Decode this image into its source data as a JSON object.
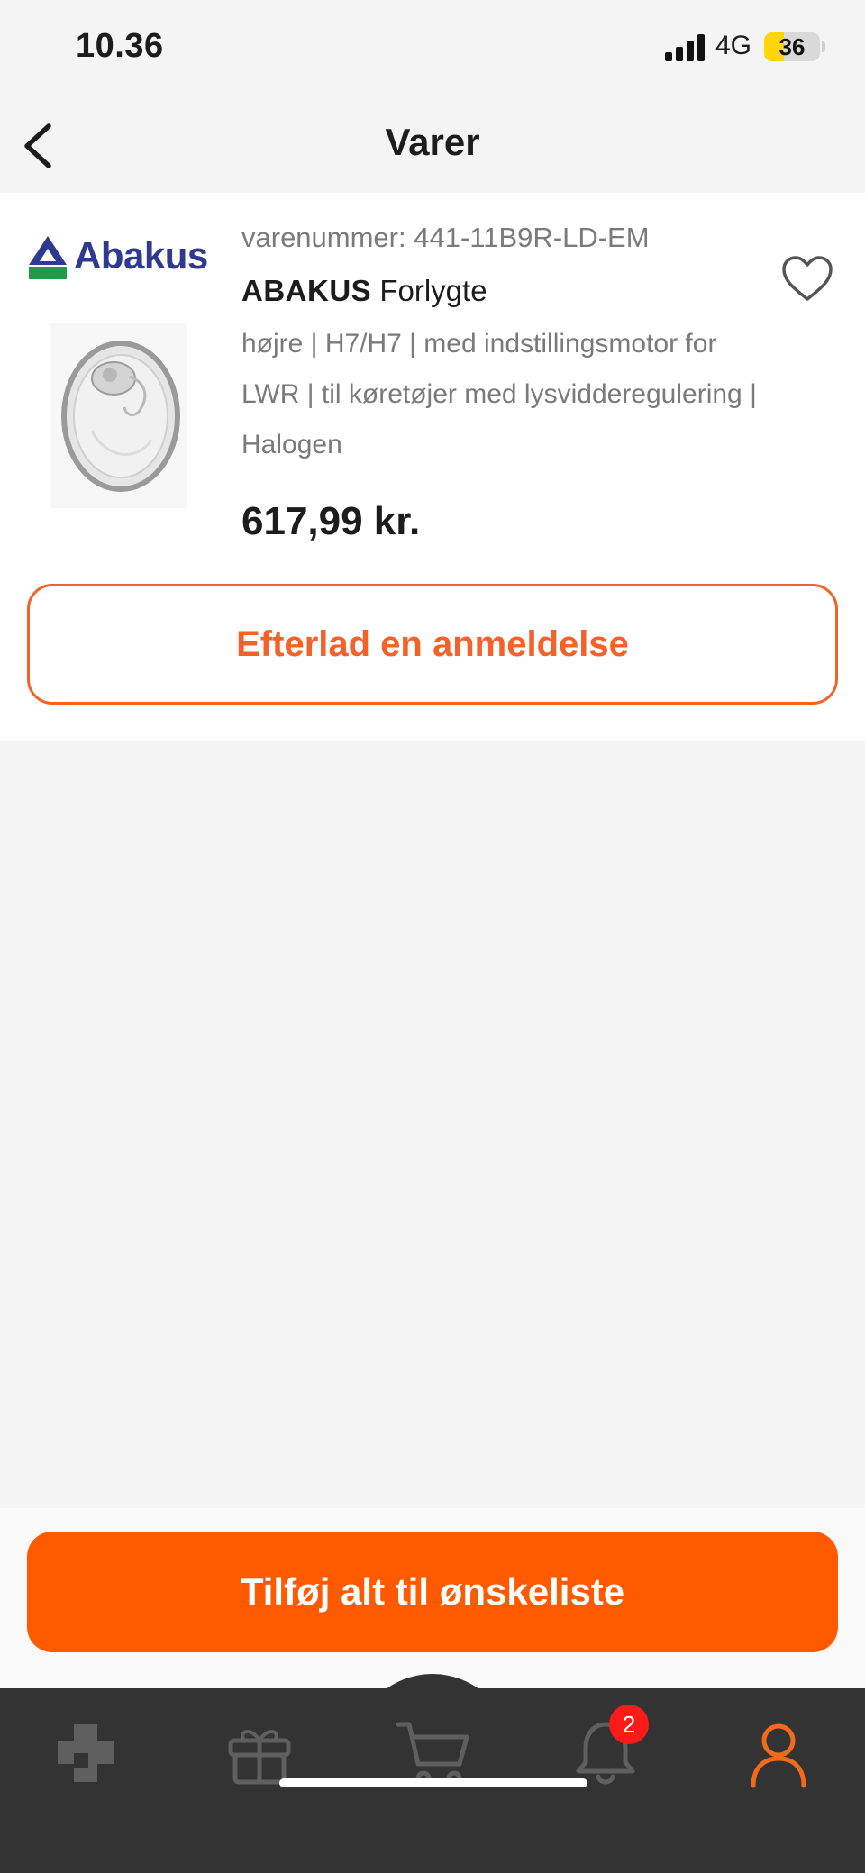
{
  "status_bar": {
    "time": "10.36",
    "network": "4G",
    "battery_level": "36",
    "battery_fraction": 0.36
  },
  "header": {
    "title": "Varer",
    "back_icon": "chevron-left-icon"
  },
  "product": {
    "brand_logo_text": "Abakus",
    "item_number": "varenummer: 441-11B9R-LD-EM",
    "brand": "ABAKUS",
    "name": "Forlygte",
    "description": "højre | H7/H7 | med indstillingsmotor for LWR | til køretøjer med lysvidderegulering | Halogen",
    "price": "617,99 kr.",
    "favorite_icon": "heart-outline-icon",
    "review_button_label": "Efterlad en anmeldelse"
  },
  "actions": {
    "wishlist_button_label": "Tilføj alt til ønskeliste"
  },
  "tab_bar": {
    "items": [
      {
        "icon": "parts-icon",
        "active": false
      },
      {
        "icon": "gift-icon",
        "active": false
      },
      {
        "icon": "cart-icon",
        "active": false
      },
      {
        "icon": "bell-icon",
        "active": false,
        "badge": "2"
      },
      {
        "icon": "person-icon",
        "active": true
      }
    ]
  },
  "colors": {
    "accent": "#ff5a00",
    "accent_outline": "#f2622a",
    "brand_logo": "#2f3a8f",
    "tab_bar_bg": "#333333",
    "tab_icon_inactive": "#5f5f5f",
    "badge": "#ff1a1a"
  }
}
